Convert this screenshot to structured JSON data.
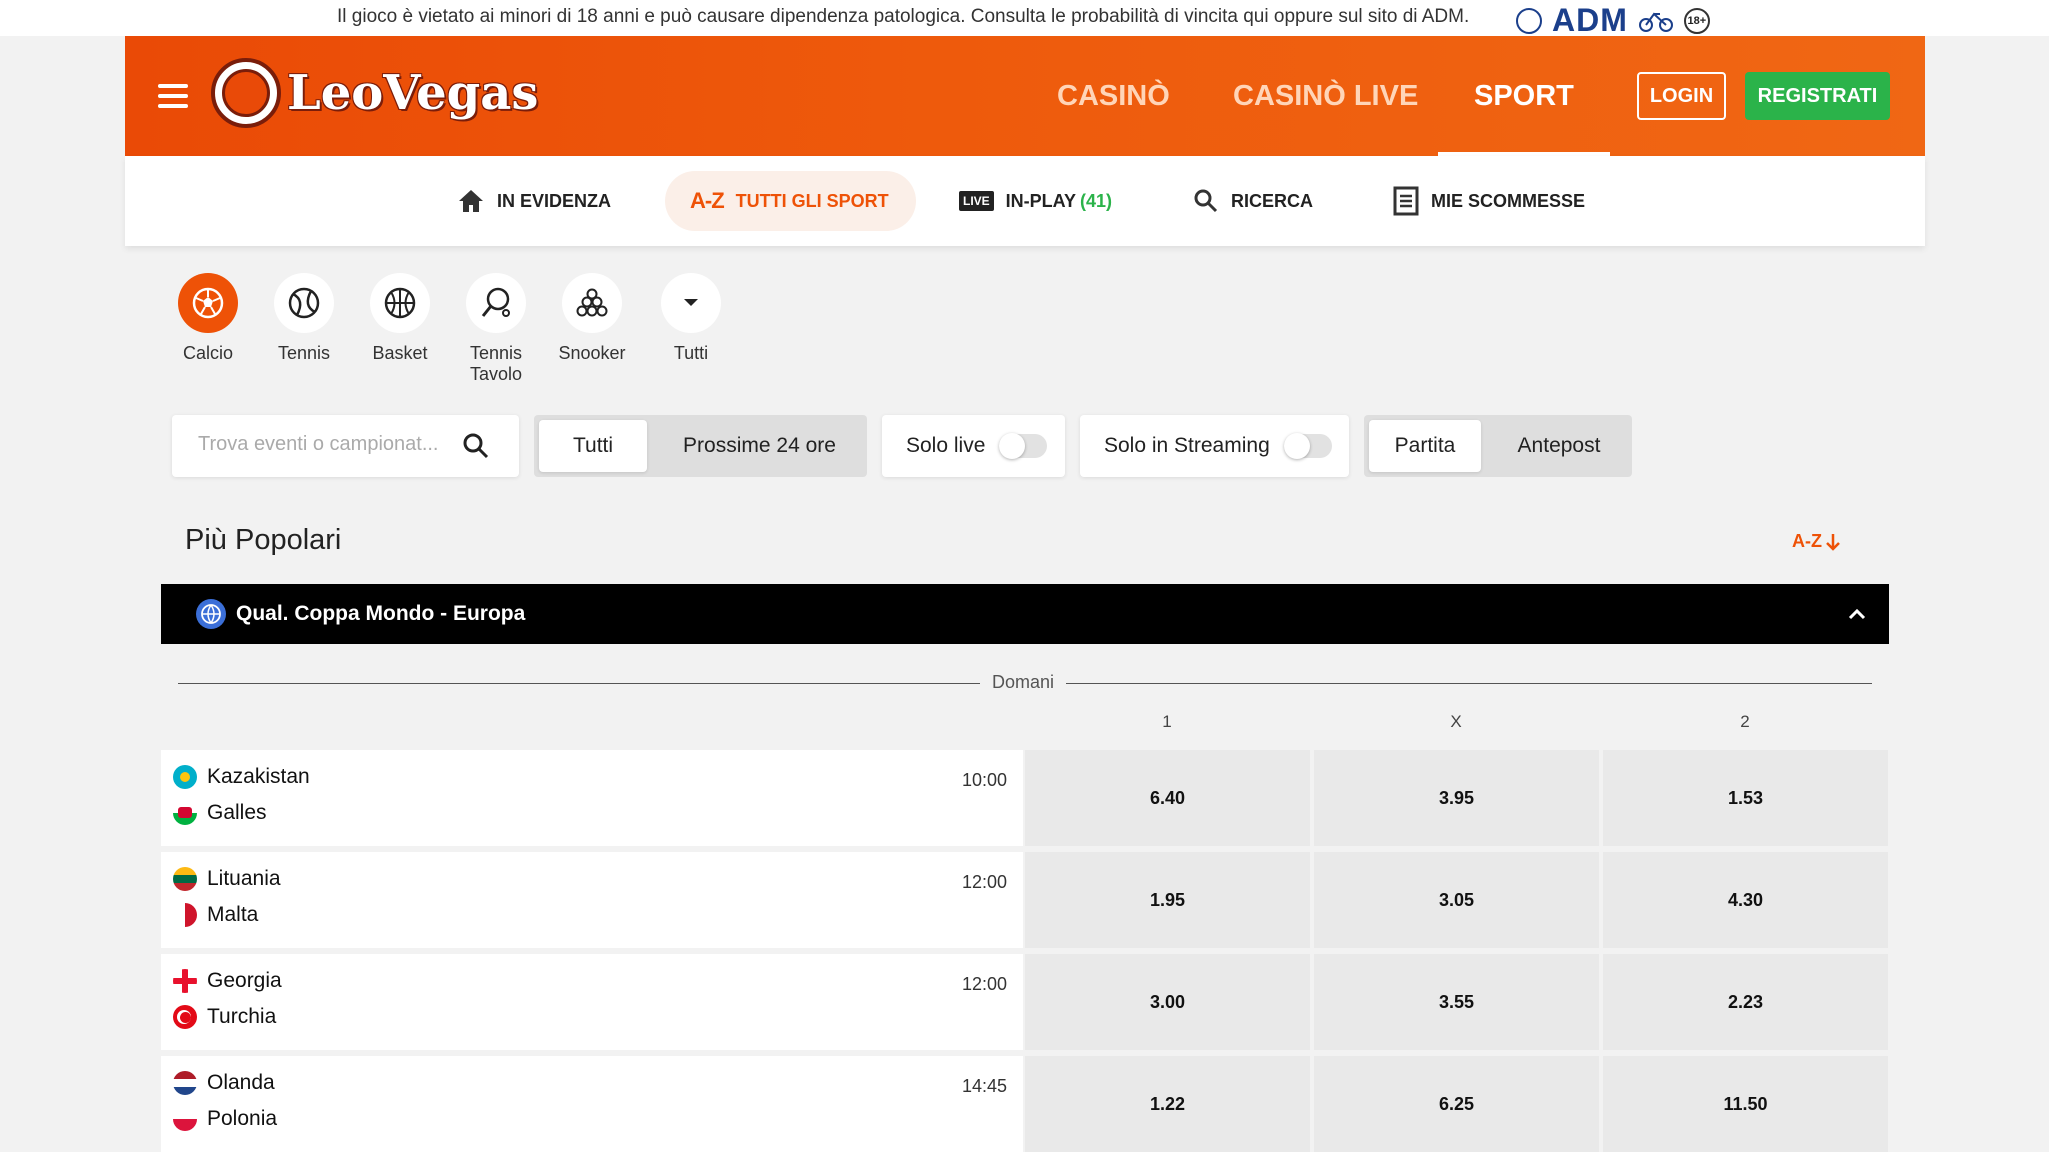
{
  "disclaimer": "Il gioco è vietato ai minori di 18 anni e può causare dipendenza patologica. Consulta le probabilità di vincita qui oppure sul sito di ADM.",
  "adm": {
    "logo_text": "ADM",
    "age_badge": "18+"
  },
  "header": {
    "logo_text": "LeoVegas",
    "nav": [
      "CASINÒ",
      "CASINÒ LIVE",
      "SPORT"
    ],
    "active_nav": "SPORT",
    "login_label": "LOGIN",
    "register_label": "REGISTRATI"
  },
  "subnav": {
    "items": [
      {
        "label": "IN EVIDENZA",
        "icon": "home-icon"
      },
      {
        "label": "TUTTI GLI SPORT",
        "icon": "a-z-icon",
        "icon_text": "A-Z",
        "active": true
      },
      {
        "label": "IN-PLAY",
        "count": "(41)",
        "icon": "live-icon",
        "icon_text": "LIVE"
      },
      {
        "label": "RICERCA",
        "icon": "search-icon"
      },
      {
        "label": "MIE SCOMMESSE",
        "icon": "receipt-icon"
      }
    ]
  },
  "sports": [
    {
      "label": "Calcio",
      "icon": "football-icon",
      "active": true
    },
    {
      "label": "Tennis",
      "icon": "tennis-ball-icon"
    },
    {
      "label": "Basket",
      "icon": "basketball-icon"
    },
    {
      "label": "Tennis Tavolo",
      "icon": "table-tennis-icon"
    },
    {
      "label": "Snooker",
      "icon": "snooker-balls-icon"
    },
    {
      "label": "Tutti",
      "icon": "caret-down-icon"
    }
  ],
  "filters": {
    "search_placeholder": "Trova eventi o campionat...",
    "time_options": [
      "Tutti",
      "Prossime 24 ore"
    ],
    "time_selected": "Tutti",
    "solo_live": {
      "label": "Solo live",
      "on": false
    },
    "solo_streaming": {
      "label": "Solo in Streaming",
      "on": false
    },
    "market_options": [
      "Partita",
      "Antepost"
    ],
    "market_selected": "Partita"
  },
  "section": {
    "title": "Più Popolari",
    "sort_label": "A-Z"
  },
  "competition": {
    "name": "Qual. Coppa Mondo - Europa",
    "date_label": "Domani",
    "odds_headers": [
      "1",
      "X",
      "2"
    ],
    "matches": [
      {
        "home": "Kazakistan",
        "away": "Galles",
        "time": "10:00",
        "odds": [
          "6.40",
          "3.95",
          "1.53"
        ]
      },
      {
        "home": "Lituania",
        "away": "Malta",
        "time": "12:00",
        "odds": [
          "1.95",
          "3.05",
          "4.30"
        ]
      },
      {
        "home": "Georgia",
        "away": "Turchia",
        "time": "12:00",
        "odds": [
          "3.00",
          "3.55",
          "2.23"
        ]
      },
      {
        "home": "Olanda",
        "away": "Polonia",
        "time": "14:45",
        "odds": [
          "1.22",
          "6.25",
          "11.50"
        ]
      }
    ]
  },
  "colors": {
    "brand_orange": "#ee5207",
    "register_green": "#2bb34a",
    "competition_bar": "#000000"
  }
}
